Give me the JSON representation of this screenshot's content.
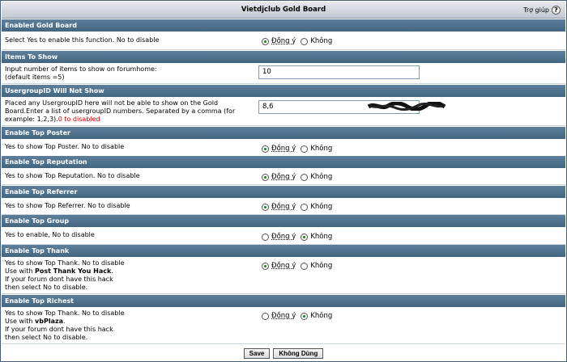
{
  "window": {
    "title": "Vietdjclub Gold Board",
    "help_label": "Trợ giúp",
    "help_glyph": "?"
  },
  "radio_labels": {
    "yes": "Đồng ý",
    "no": "Không"
  },
  "settings": [
    {
      "header": "Enabled Gold Board",
      "desc": "Select Yes to enable this function. No to disable",
      "value": "yes"
    },
    {
      "header": "Items To Show",
      "desc_line1": "Input number of items to show on forumhome:",
      "desc_line2": "(default items =5)",
      "input_value": "10"
    },
    {
      "header": "UsergroupID Will Not Show",
      "desc_text": "Placed any UsergroupID here will not be able to show on the Gold Board.Enter a list of usergroupID numbers. Separated by a comma (for example: 1,2,3).",
      "desc_red": "0 to disabled",
      "input_value": "8,6"
    },
    {
      "header": "Enable Top Poster",
      "desc": "Yes to show Top Poster. No to disable",
      "value": "yes"
    },
    {
      "header": "Enable Top Reputation",
      "desc": "Yes to show Top Reputation. No to disable",
      "value": "yes"
    },
    {
      "header": "Enable Top Referrer",
      "desc": "Yes to show Top Referrer. No to disable",
      "value": "yes"
    },
    {
      "header": "Enable Top Group",
      "desc": "Yes to enable, No to disable",
      "value": "no"
    },
    {
      "header": "Enable Top Thank",
      "desc_line1": "Yes to show Top Thank. No to disable",
      "desc_line2_pre": "Use with ",
      "desc_line2_bold": "Post Thank You Hack",
      "desc_line2_post": ".",
      "desc_line3": "If your forum dont have this hack",
      "desc_line4": "then select No to disable.",
      "value": "yes"
    },
    {
      "header": "Enable Top Richest",
      "desc_line1": "Yes to show Top Thank. No to disable",
      "desc_line2_pre": "Use with ",
      "desc_line2_bold": "vbPlaza",
      "desc_line2_post": ".",
      "desc_line3": "If your forum dont have this hack",
      "desc_line4": "then select No to disable.",
      "value": "no"
    }
  ],
  "buttons": {
    "save": "Save",
    "reset": "Không Dùng"
  },
  "colors": {
    "section_bg": "#4f7190",
    "annotation_arrow": "#e01010",
    "radio_dot": "#1b7a1b"
  }
}
